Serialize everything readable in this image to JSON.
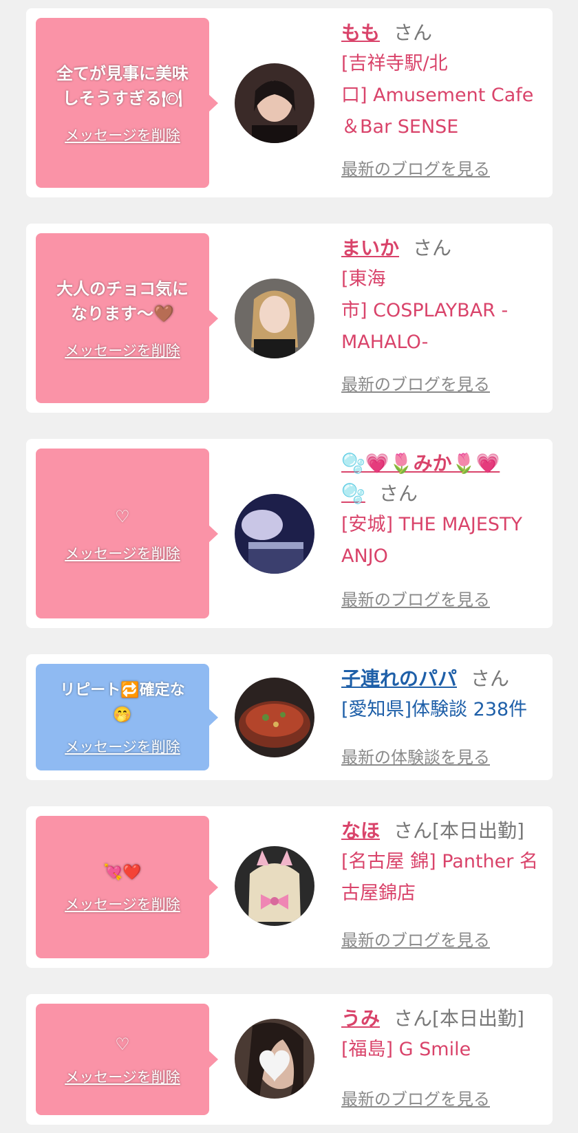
{
  "delete_label": "メッセージを削除",
  "san_label": "さん",
  "cards": [
    {
      "message": "全てが見事に美味\nしそうすぎる🍽",
      "name": "もも",
      "status": "",
      "shop": "[吉祥寺駅/北\n口] Amusement Cafe\n＆Bar SENSE",
      "link": "最新のブログを見る"
    },
    {
      "message": "大人のチョコ気に\nなります〜🤎",
      "name": "まいか",
      "status": "",
      "shop": "[東海\n市] COSPLAYBAR -\nMAHALO-",
      "link": "最新のブログを見る"
    },
    {
      "message": "♡",
      "name": "🫧💗🌷みか🌷💗\n🫧",
      "status": "",
      "shop": "[安城] THE MAJESTY\nANJO",
      "link": "最新のブログを見る"
    },
    {
      "message": "リピート🔁確定な\n🤭",
      "name": "子連れのパパ",
      "status": "",
      "shop": "[愛知県]体験談 238件",
      "link": "最新の体験談を見る"
    },
    {
      "message": "💘❤️",
      "name": "なほ",
      "status": "[本日出勤]",
      "shop": "[名古屋 錦] Panther 名\n古屋錦店",
      "link": "最新のブログを見る"
    },
    {
      "message": "♡",
      "name": "うみ",
      "status": "[本日出勤]",
      "shop": "[福島] G Smile",
      "link": "最新のブログを見る"
    }
  ]
}
